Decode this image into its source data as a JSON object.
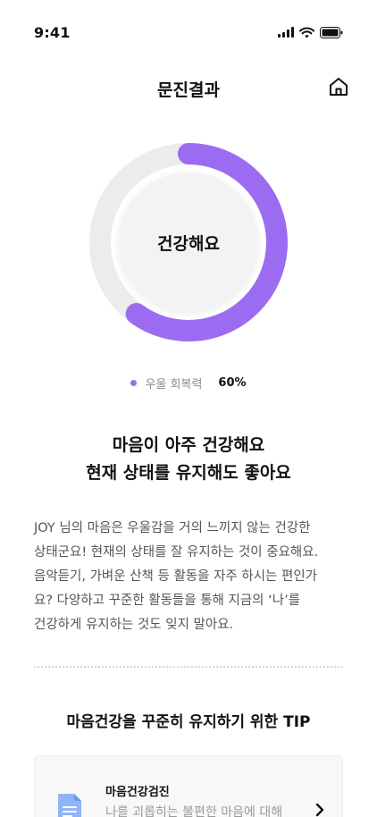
{
  "status_bar": {
    "time": "9:41",
    "icons": [
      "signal-icon",
      "wifi-icon",
      "battery-icon"
    ]
  },
  "header": {
    "title": "문진결과",
    "home_icon": "home-icon"
  },
  "gauge": {
    "center_label": "건강해요",
    "progress": 0.6,
    "track_color": "#ececec",
    "fill_color": "#9b6cf2"
  },
  "legend": {
    "label": "우울 회복력",
    "value": "60%"
  },
  "result": {
    "line1": "마음이 아주 건강해요",
    "line2": "현재 상태를 유지해도 좋아요"
  },
  "description": {
    "lines": [
      "JOY 님의 마음은 우울감을 거의 느끼지 않는 건강한",
      "상태군요! 현재의 상태를 잘 유지하는 것이 중요해요.",
      "음악듣기, 가벼운 산책 등 활동을 자주 하시는 편인가",
      "요? 다양하고 꾸준한 활동들을 통해 지금의 ‘나’를",
      "건강하게 유지하는 것도 잊지 말아요."
    ]
  },
  "tips": {
    "title": "마음건강을 꾸준히 유지하기 위한 TIP",
    "card": {
      "title": "마음건강검진",
      "description": "나를 괴롭히는 불편한 마음에 대해",
      "icon": "document-icon",
      "action_icon": "chevron-right-icon"
    }
  }
}
